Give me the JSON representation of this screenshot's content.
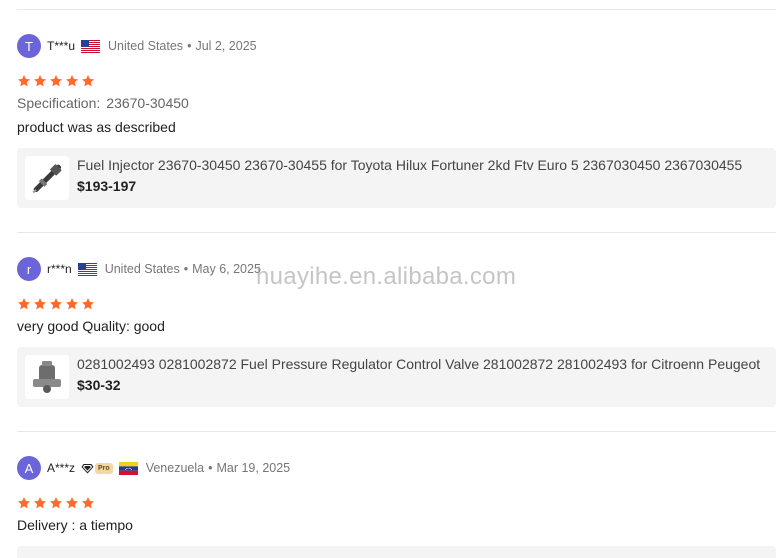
{
  "reviews": [
    {
      "avatar_letter": "T",
      "user": "T***u",
      "country": "United States",
      "date": "Jul 2, 2025",
      "rating": 5,
      "spec_label": "Specification:",
      "spec_value": "23670-30450",
      "text": "product was as described",
      "product": {
        "title": "Fuel Injector 23670-30450 23670-30455 for Toyota Hilux Fortuner 2kd Ftv Euro 5 2367030450 2367030455",
        "price": "$193-197"
      }
    },
    {
      "avatar_letter": "r",
      "user": "r***n",
      "country": "United States",
      "date": "May 6, 2025",
      "rating": 5,
      "text": "very good Quality: good",
      "product": {
        "title": "0281002493 0281002872 Fuel Pressure Regulator Control Valve 281002872 281002493 for Citroenn Peugeot",
        "price": "$30-32"
      }
    },
    {
      "avatar_letter": "A",
      "user": "A***z",
      "pro_badge": "Pro",
      "country": "Venezuela",
      "date": "Mar 19, 2025",
      "rating": 5,
      "text": "Delivery : a tiempo"
    }
  ],
  "watermark": "huayihe.en.alibaba.com",
  "colors": {
    "avatar": "#6a65d8",
    "star": "#ff6a2a"
  },
  "icons": {
    "star": "star-icon",
    "us_flag": "us-flag-icon",
    "ve_flag": "venezuela-flag-icon",
    "diamond": "diamond-icon"
  }
}
